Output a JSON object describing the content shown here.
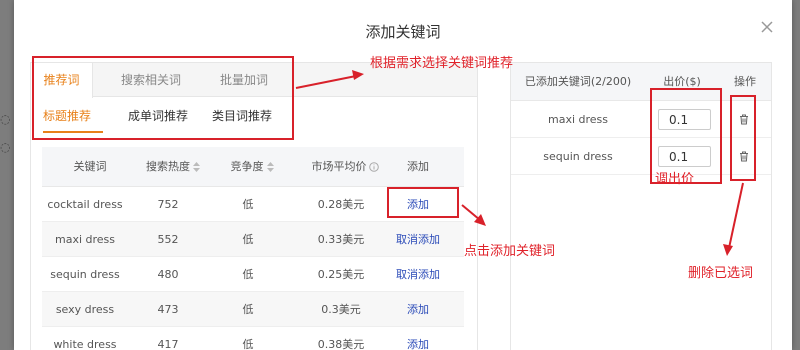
{
  "modal": {
    "title": "添加关键词"
  },
  "tabs": [
    {
      "label": "推荐词",
      "active": true
    },
    {
      "label": "搜索相关词",
      "active": false
    },
    {
      "label": "批量加词",
      "active": false
    }
  ],
  "subtabs": [
    {
      "label": "标题推荐",
      "active": true
    },
    {
      "label": "成单词推荐",
      "active": false
    },
    {
      "label": "类目词推荐",
      "active": false
    }
  ],
  "table": {
    "headers": {
      "keyword": "关键词",
      "search_heat": "搜索热度",
      "competition": "竞争度",
      "avg_price": "市场平均价",
      "add": "添加"
    },
    "rows": [
      {
        "keyword": "cocktail dress",
        "heat": "752",
        "competition": "低",
        "price": "0.28美元",
        "action": "添加"
      },
      {
        "keyword": "maxi dress",
        "heat": "552",
        "competition": "低",
        "price": "0.33美元",
        "action": "取消添加"
      },
      {
        "keyword": "sequin dress",
        "heat": "480",
        "competition": "低",
        "price": "0.25美元",
        "action": "取消添加"
      },
      {
        "keyword": "sexy dress",
        "heat": "473",
        "competition": "低",
        "price": "0.3美元",
        "action": "添加"
      },
      {
        "keyword": "white dress",
        "heat": "417",
        "competition": "低",
        "price": "0.38美元",
        "action": "添加"
      }
    ]
  },
  "selected": {
    "headers": {
      "keyword": "已添加关键词(2/200)",
      "bid": "出价($)",
      "op": "操作"
    },
    "rows": [
      {
        "keyword": "maxi dress",
        "bid": "0.1"
      },
      {
        "keyword": "sequin dress",
        "bid": "0.1"
      }
    ]
  },
  "annotations": {
    "tabs_note": "根据需求选择关键词推荐",
    "add_note": "点击添加关键词",
    "bid_note": "调出价",
    "delete_note": "删除已选词"
  },
  "colors": {
    "accent": "#e8811a",
    "link": "#2b4bb8",
    "annotation": "#d8212a"
  }
}
